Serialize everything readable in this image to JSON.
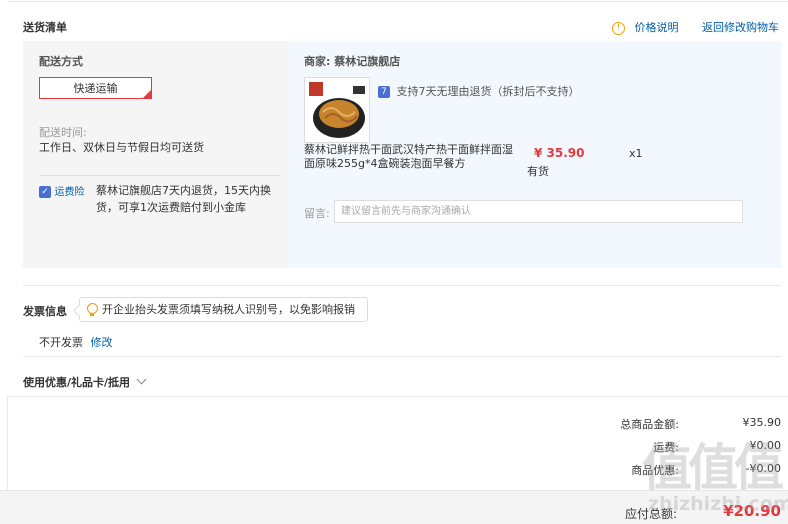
{
  "section": {
    "title": "送货清单",
    "price_info_label": "价格说明",
    "back_to_cart": "返回修改购物车"
  },
  "shipping": {
    "method_label": "配送方式",
    "method_value": "快递运输",
    "time_label": "配送时间:",
    "time_value": "工作日、双休日与节假日均可送货",
    "insurance_label": "运费险",
    "insurance_text": "蔡林记旗舰店7天内退货，15天内换货，可享1次运费赔付到小金库"
  },
  "merchant": {
    "label": "商家:",
    "name": "蔡林记旗舰店",
    "return_policy": "支持7天无理由退货（拆封后不支持）",
    "product_title": "蔡林记鲜拌热干面武汉特产热干面鲜拌面湿面原味255g*4盒碗装泡面早餐方",
    "price": "¥ 35.90",
    "stock": "有货",
    "quantity": "x1",
    "message_label": "留言:",
    "message_placeholder": "建议留言前先与商家沟通确认"
  },
  "invoice": {
    "title": "发票信息",
    "tip": "开企业抬头发票须填写纳税人识别号，以免影响报销",
    "value": "不开发票",
    "modify": "修改"
  },
  "coupon": {
    "label": "使用优惠/礼品卡/抵用"
  },
  "summary": {
    "goods_total_label": "总商品金额:",
    "goods_total_value": "¥35.90",
    "freight_label": "运费:",
    "freight_value": "¥0.00",
    "discount_label": "商品优惠:",
    "discount_value": "-¥0.00",
    "payable_label": "应付总额:",
    "payable_value": "¥20.90"
  },
  "watermark": {
    "glyphs": "值值值",
    "site": "zhizhizhi.com"
  },
  "colors": {
    "accent_red": "#e4393c",
    "link_blue": "#005ea7",
    "panel_blue": "#f3f8fe",
    "panel_gray": "#f5f5f5"
  }
}
